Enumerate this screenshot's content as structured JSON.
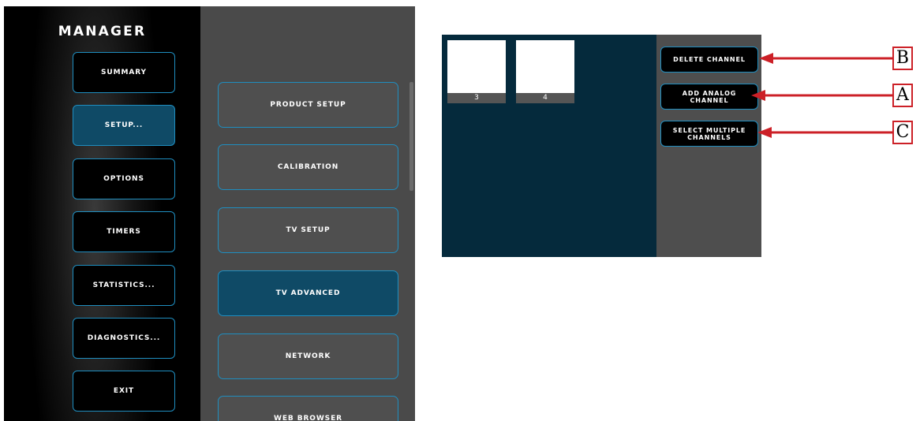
{
  "manager": {
    "title": "MANAGER"
  },
  "sidebar": {
    "items": [
      {
        "label": "SUMMARY",
        "active": false
      },
      {
        "label": "SETUP...",
        "active": true
      },
      {
        "label": "OPTIONS",
        "active": false
      },
      {
        "label": "TIMERS",
        "active": false
      },
      {
        "label": "STATISTICS...",
        "active": false
      },
      {
        "label": "DIAGNOSTICS...",
        "active": false
      },
      {
        "label": "EXIT",
        "active": false
      }
    ]
  },
  "submenu": {
    "items": [
      {
        "label": "PRODUCT SETUP",
        "active": false
      },
      {
        "label": "CALIBRATION",
        "active": false
      },
      {
        "label": "TV SETUP",
        "active": false
      },
      {
        "label": "TV ADVANCED",
        "active": true
      },
      {
        "label": "NETWORK",
        "active": false
      },
      {
        "label": "WEB BROWSER",
        "active": false
      }
    ]
  },
  "channels": [
    {
      "number": "3"
    },
    {
      "number": "4"
    }
  ],
  "actions": {
    "delete_channel": "DELETE CHANNEL",
    "add_analog_line1": "ADD ANALOG",
    "add_analog_line2": "CHANNEL",
    "select_multiple_line1": "SELECT MULTIPLE",
    "select_multiple_line2": "CHANNELS"
  },
  "callouts": {
    "b": "B",
    "a": "A",
    "c": "C"
  },
  "colors": {
    "accent_border": "#1f8ec0",
    "active_fill": "#0f4a66",
    "channel_area": "#052a3c",
    "callout_red": "#cc2027"
  }
}
